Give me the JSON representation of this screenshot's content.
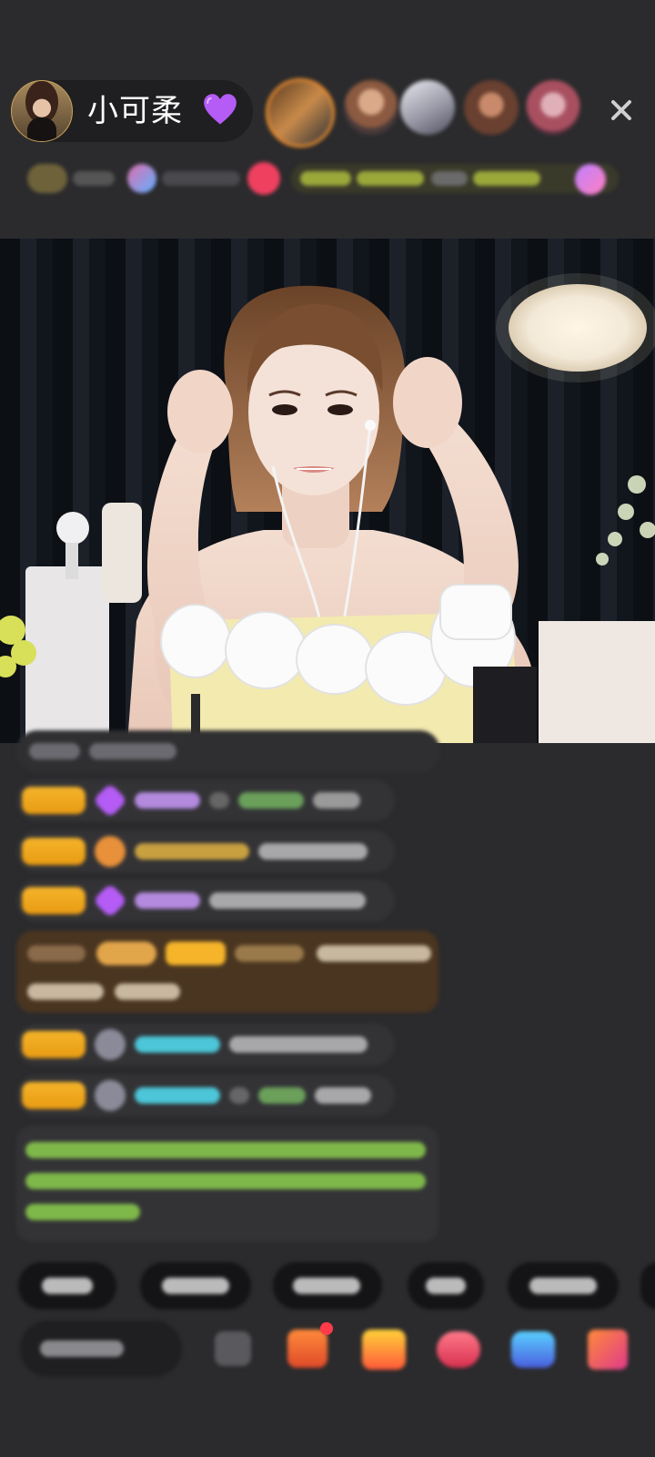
{
  "header": {
    "anchor_name": "小可柔",
    "heart_emoji": "💜",
    "viewer_avatars": [
      "viewer-1",
      "viewer-2",
      "viewer-3",
      "viewer-4",
      "viewer-5"
    ],
    "close_icon": "close-icon"
  },
  "colors": {
    "background": "#2b2b2d",
    "badge_orange": "#f5b42a",
    "heart_purple": "#b45cf5",
    "chat_pill": "#333336",
    "highlight_brown": "#4a3520",
    "green_text": "#8fcf5a",
    "cyan_text": "#4cc6d8"
  },
  "icons": {
    "avatar": "anchor-avatar",
    "heart": "purple-heart-icon",
    "close": "close-icon",
    "chat": "chat-bubble-icon",
    "gifts": [
      "gift-box-icon",
      "gift-box-icon",
      "gift-box-icon",
      "gift-box-icon",
      "gift-box-icon"
    ]
  }
}
